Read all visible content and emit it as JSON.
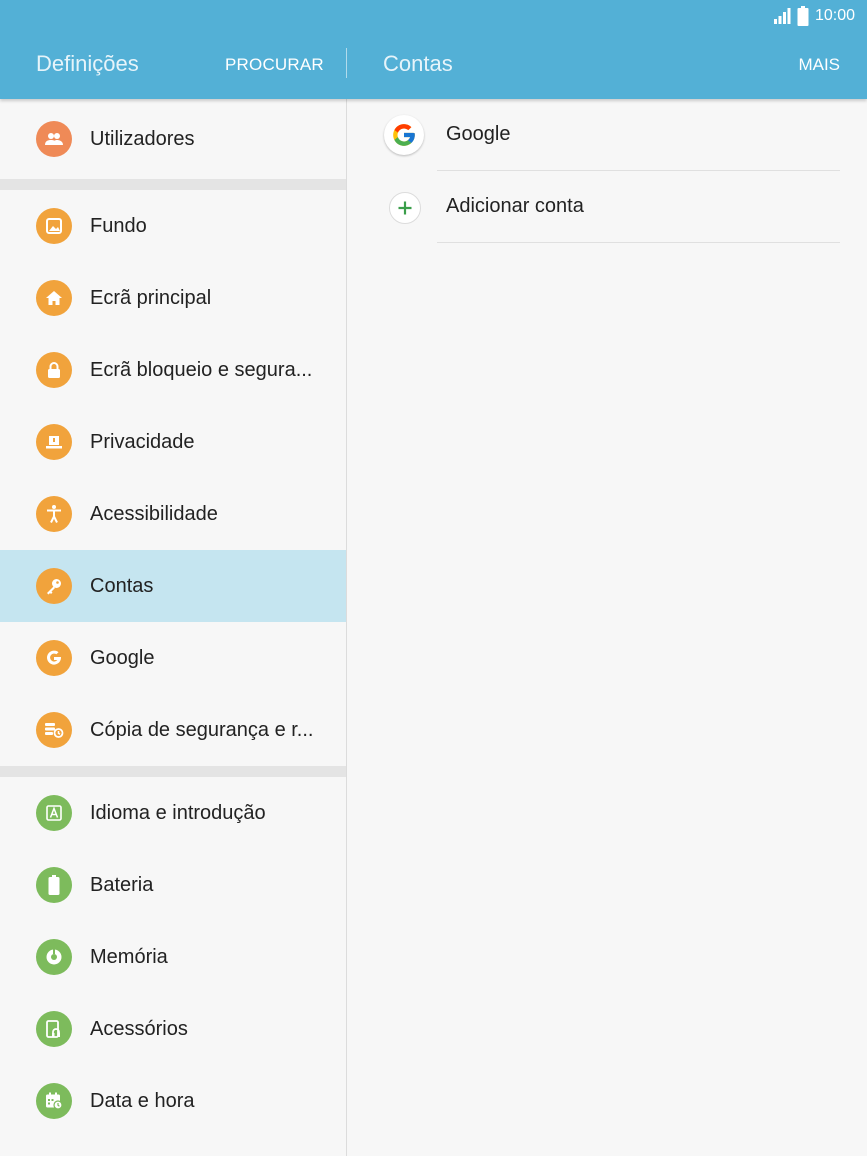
{
  "status_bar": {
    "time": "10:00"
  },
  "header": {
    "left_title": "Definições",
    "search_label": "PROCURAR",
    "right_title": "Contas",
    "more_label": "MAIS"
  },
  "colors": {
    "header_bg": "#53b0d6",
    "selected_row": "#c5e5f0",
    "orange_icon": "#f1a33c",
    "salmon_icon": "#ef8a57",
    "green_icon": "#7dbb5c"
  },
  "sidebar": {
    "groups": [
      [
        {
          "label": "Utilizadores",
          "icon": "users-icon"
        }
      ],
      [
        {
          "label": "Fundo",
          "icon": "wallpaper-icon"
        },
        {
          "label": "Ecrã principal",
          "icon": "home-icon"
        },
        {
          "label": "Ecrã bloqueio e segura...",
          "icon": "lock-icon"
        },
        {
          "label": "Privacidade",
          "icon": "privacy-icon"
        },
        {
          "label": "Acessibilidade",
          "icon": "accessibility-icon"
        },
        {
          "label": "Contas",
          "icon": "key-icon",
          "selected": true
        },
        {
          "label": "Google",
          "icon": "google-icon"
        },
        {
          "label": "Cópia de segurança e r...",
          "icon": "backup-icon"
        }
      ],
      [
        {
          "label": "Idioma e introdução",
          "icon": "language-icon"
        },
        {
          "label": "Bateria",
          "icon": "battery-icon"
        },
        {
          "label": "Memória",
          "icon": "memory-icon"
        },
        {
          "label": "Acessórios",
          "icon": "accessories-icon"
        },
        {
          "label": "Data e hora",
          "icon": "calendar-icon"
        }
      ]
    ]
  },
  "accounts": {
    "items": [
      {
        "label": "Google",
        "icon": "google-logo-icon"
      },
      {
        "label": "Adicionar conta",
        "icon": "add-icon"
      }
    ]
  }
}
